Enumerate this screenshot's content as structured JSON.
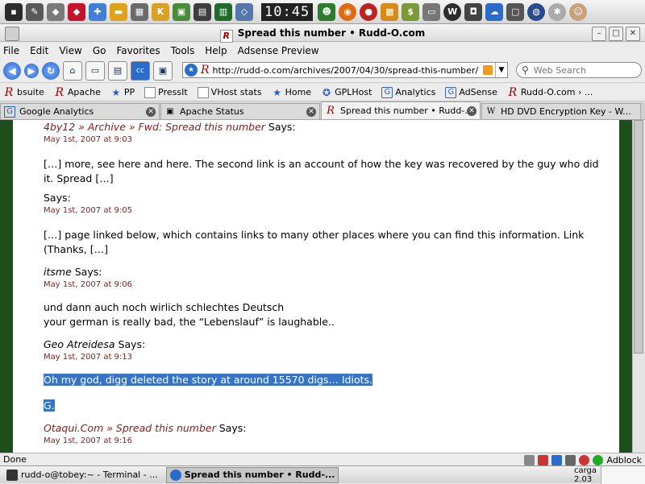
{
  "panel": {
    "clock": "10:45",
    "icons": [
      "terminal-icon",
      "ruby-icon",
      "network-icon",
      "folder-icon",
      "calculator-icon",
      "kate-icon",
      "image-icon",
      "save-icon",
      "dictionary-icon",
      "network-icon",
      "clock-icon",
      "messenger-icon",
      "firefox-icon",
      "shutdown-icon",
      "tools-icon",
      "money-icon",
      "wordpress-icon",
      "camera-icon",
      "weather-icon",
      "monitor-icon",
      "globe-icon",
      "user-icon"
    ]
  },
  "window": {
    "title": "Spread this number • Rudd-O.com"
  },
  "menu": [
    "File",
    "Edit",
    "View",
    "Go",
    "Favorites",
    "Tools",
    "Help",
    "Adsense Preview"
  ],
  "nav": {
    "url": "http://rudd-o.com/archives/2007/04/30/spread-this-number/",
    "search_placeholder": "Web Search"
  },
  "bookmarks": [
    {
      "label": "bsuite",
      "icon": "r"
    },
    {
      "label": "Apache",
      "icon": "r"
    },
    {
      "label": "PP",
      "icon": "s"
    },
    {
      "label": "PressIt",
      "icon": "d"
    },
    {
      "label": "VHost stats",
      "icon": "d"
    },
    {
      "label": "Home",
      "icon": "s"
    },
    {
      "label": "GPLHost",
      "icon": "s"
    },
    {
      "label": "Analytics",
      "icon": "g"
    },
    {
      "label": "AdSense",
      "icon": "g"
    },
    {
      "label": "Rudd-O.com › ...",
      "icon": "r"
    }
  ],
  "tabs": [
    {
      "label": "Google Analytics",
      "icon": "G",
      "active": false
    },
    {
      "label": "Apache Status",
      "icon": "▣",
      "active": false
    },
    {
      "label": "Spread this number • Rudd-...",
      "icon": "R",
      "active": true
    },
    {
      "label": "HD DVD Encryption Key - W...",
      "icon": "W",
      "active": false
    }
  ],
  "comments": [
    {
      "author_link": "4by12 » Archive » Fwd: Spread this number",
      "says": "Says:",
      "date": "May 1st, 2007 at 9:03",
      "body": [
        "[…] more, see here and here. The second link is an account of how the key was recovered by the guy who did it. Spread […]"
      ]
    },
    {
      "author_link": "",
      "says": "Says:",
      "date": "May 1st, 2007 at 9:05",
      "body": [
        "[…] page linked below, which contains links to many other places where you can find this information. Link (Thanks, […]"
      ]
    },
    {
      "author_plain": "itsme",
      "says": "Says:",
      "date": "May 1st, 2007 at 9:06",
      "body": [
        "und dann auch noch wirlich schlechtes Deutsch",
        "your german is really bad, the “Lebenslauf” is laughable.."
      ]
    },
    {
      "author_plain": "Geo Atreidesa",
      "says": "Says:",
      "date": "May 1st, 2007 at 9:13",
      "body": [
        "Oh my god, digg deleted the story at around 15570 digs… Idiots.",
        "G."
      ]
    },
    {
      "author_link": "Otaqui.Com » Spread this number",
      "says": "Says:",
      "date": "May 1st, 2007 at 9:16",
      "body": []
    }
  ],
  "status": {
    "text": "Done",
    "adblock": "Adblock"
  },
  "taskbar": [
    {
      "label": "rudd-o@tobey:~ - Terminal - ...",
      "active": false
    },
    {
      "label": "Spread this number • Rudd-...",
      "active": true
    }
  ],
  "load": {
    "label": "carga",
    "value": "2.03"
  }
}
